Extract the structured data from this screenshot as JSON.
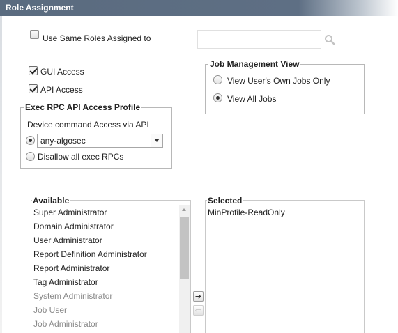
{
  "header": {
    "title": "Role Assignment"
  },
  "same_roles": {
    "label": "Use Same Roles Assigned to",
    "checked": false,
    "search_value": "",
    "search_icon": "magnifier-icon"
  },
  "access": {
    "gui": {
      "label": "GUI Access",
      "checked": true
    },
    "api": {
      "label": "API Access",
      "checked": true
    }
  },
  "exec_rpc": {
    "legend": "Exec RPC API Access Profile",
    "subtitle": "Device command Access via API",
    "selected_profile": "any-algosec",
    "disallow_label": "Disallow all exec RPCs",
    "selected_option": "profile"
  },
  "job_view": {
    "legend": "Job Management View",
    "options": [
      "View User's Own Jobs Only",
      "View All Jobs"
    ],
    "selected_index": 1
  },
  "available": {
    "title": "Available",
    "items": [
      "Super Administrator",
      "Domain Administrator",
      "User Administrator",
      "Report Definition Administrator",
      "Report Administrator",
      "Tag Administrator",
      "System Administrator",
      "Job User",
      "Job Administrator"
    ],
    "disabled_from_index": 6
  },
  "selected": {
    "title": "Selected",
    "items": [
      "MinProfile-ReadOnly"
    ]
  },
  "transfer": {
    "add_icon": "arrow-right-icon",
    "remove_icon": "arrow-left-icon",
    "add_glyph": "➔",
    "remove_glyph": "⇦"
  }
}
